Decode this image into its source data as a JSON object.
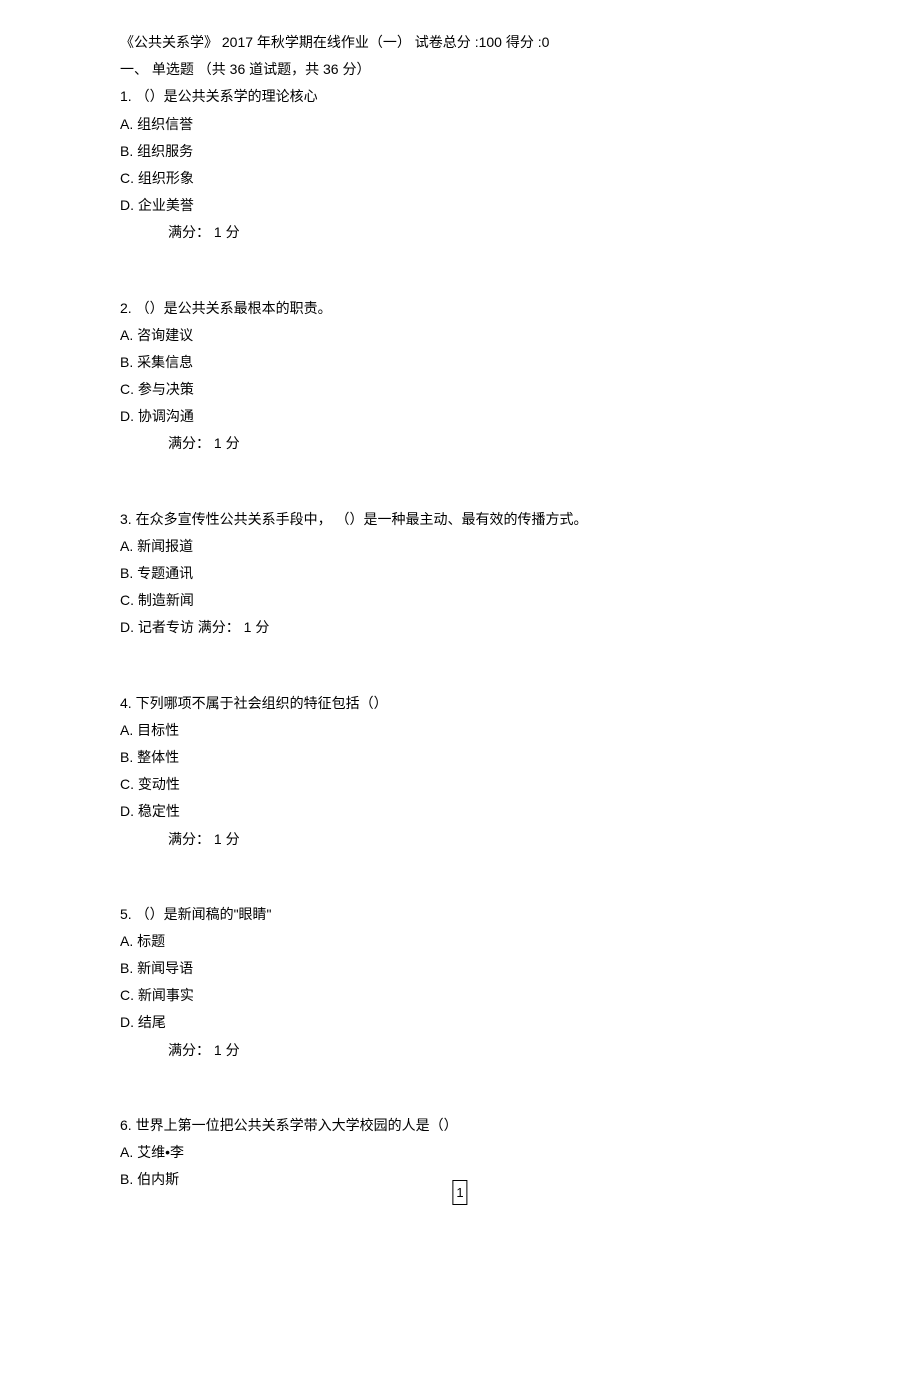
{
  "header": "《公共关系学》 2017 年秋学期在线作业（一）  试卷总分 :100 得分 :0",
  "sectionTitle": "一、 单选题 （共 36 道试题，共 36 分）",
  "questions": [
    {
      "num": "1.",
      "text": "（）是公共关系学的理论核心",
      "options": [
        {
          "label": "A.",
          "text": "组织信誉"
        },
        {
          "label": "B.",
          "text": "组织服务"
        },
        {
          "label": "C.",
          "text": "组织形象"
        },
        {
          "label": "D.",
          "text": "企业美誉"
        }
      ],
      "score": "满分： 1 分",
      "inlineScore": false
    },
    {
      "num": "2.",
      "text": "（）是公共关系最根本的职责。",
      "options": [
        {
          "label": "A.",
          "text": "咨询建议"
        },
        {
          "label": "B.",
          "text": "采集信息"
        },
        {
          "label": "C.",
          "text": "参与决策"
        },
        {
          "label": "D.",
          "text": "协调沟通"
        }
      ],
      "score": "满分： 1 分",
      "inlineScore": false
    },
    {
      "num": "3.",
      "text": "在众多宣传性公共关系手段中， （）是一种最主动、最有效的传播方式。",
      "options": [
        {
          "label": "A.",
          "text": "新闻报道"
        },
        {
          "label": "B.",
          "text": "专题通讯"
        },
        {
          "label": "C.",
          "text": "制造新闻"
        },
        {
          "label": "D.",
          "text": "记者专访 满分： 1 分"
        }
      ],
      "score": "",
      "inlineScore": true
    },
    {
      "num": "4.",
      "text": "下列哪项不属于社会组织的特征包括（）",
      "options": [
        {
          "label": "A.",
          "text": "目标性"
        },
        {
          "label": "B.",
          "text": "整体性"
        },
        {
          "label": "C.",
          "text": "变动性"
        },
        {
          "label": "D.",
          "text": "稳定性"
        }
      ],
      "score": "满分： 1 分",
      "inlineScore": false
    },
    {
      "num": "5.",
      "text": "（）是新闻稿的\"眼睛\"",
      "options": [
        {
          "label": "A.",
          "text": "标题"
        },
        {
          "label": "B.",
          "text": "新闻导语"
        },
        {
          "label": "C.",
          "text": "新闻事实"
        },
        {
          "label": "D.",
          "text": "结尾"
        }
      ],
      "score": "满分： 1 分",
      "inlineScore": false
    },
    {
      "num": "6.",
      "text": "世界上第一位把公共关系学带入大学校园的人是（）",
      "options": [
        {
          "label": "A.",
          "text": "艾维•李"
        },
        {
          "label": "B.",
          "text": "伯内斯"
        }
      ],
      "score": "",
      "inlineScore": true
    }
  ],
  "pageNumber": "1"
}
